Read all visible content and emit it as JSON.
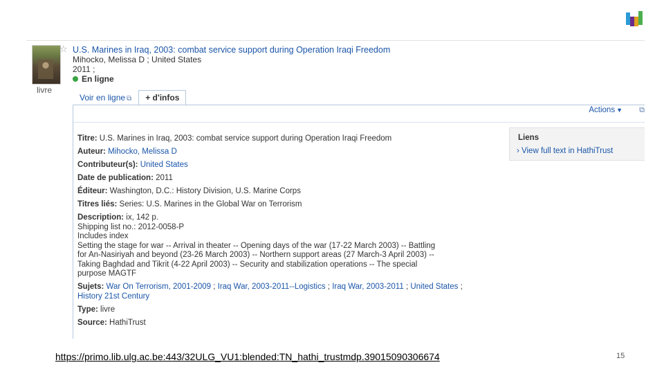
{
  "record": {
    "title": "U.S. Marines in Iraq, 2003: combat service support during Operation Iraqi Freedom",
    "author_line": "Mihocko, Melissa D ; United States",
    "date_line": "2011 ;",
    "availability": "En ligne",
    "type_label": "livre",
    "availability_color": "#3aa443"
  },
  "tabs": [
    {
      "label": "Voir en ligne",
      "icon": "external-link-icon"
    },
    {
      "label": "+ d'infos"
    }
  ],
  "toolbar": {
    "actions_label": "Actions"
  },
  "details": {
    "titre": {
      "label": "Titre:",
      "value": "U.S. Marines in Iraq, 2003: combat service support during Operation Iraqi Freedom"
    },
    "auteur": {
      "label": "Auteur:",
      "value": "Mihocko, Melissa D"
    },
    "contributeur": {
      "label": "Contributeur(s):",
      "value": "United States"
    },
    "date": {
      "label": "Date de publication:",
      "value": "2011"
    },
    "editeur": {
      "label": "Éditeur:",
      "value": "Washington, D.C.: History Division, U.S. Marine Corps"
    },
    "titres_lies": {
      "label": "Titres liés:",
      "value": "Series: U.S. Marines in the Global War on Terrorism"
    },
    "description": {
      "label": "Description:",
      "value": "ix, 142 p.",
      "lines": [
        "Shipping list no.: 2012-0058-P",
        "Includes index",
        "Setting the stage for war -- Arrival in theater -- Opening days of the war (17-22 March 2003) -- Battling",
        "for An-Nasiriyah and beyond (23-26 March 2003) -- Northern support areas (27 March-3 April 2003) --",
        "Taking Baghdad and Tikrit (4-22 April 2003) -- Security and stabilization operations -- The special",
        "purpose MAGTF"
      ]
    },
    "sujets": {
      "label": "Sujets:",
      "items": [
        "War On Terrorism, 2001-2009",
        "Iraq War, 2003-2011--Logistics",
        "Iraq War, 2003-2011",
        "United States",
        "History",
        "21st Century"
      ],
      "separators": [
        " ; ",
        " ; ",
        " ; ",
        " ; "
      ]
    },
    "type": {
      "label": "Type:",
      "value": "livre"
    },
    "source": {
      "label": "Source:",
      "value": "HathiTrust"
    }
  },
  "links": {
    "title": "Liens",
    "item": "› View full text in HathiTrust"
  },
  "footer": {
    "url": "https://primo.lib.ulg.ac.be:443/32ULG_VU1:blended:TN_hathi_trustmdp.39015090306674",
    "page_number": "15"
  },
  "colors": {
    "link": "#1a55a8",
    "tab_border": "#b6c8de",
    "links_bg": "#f3f3f3"
  }
}
